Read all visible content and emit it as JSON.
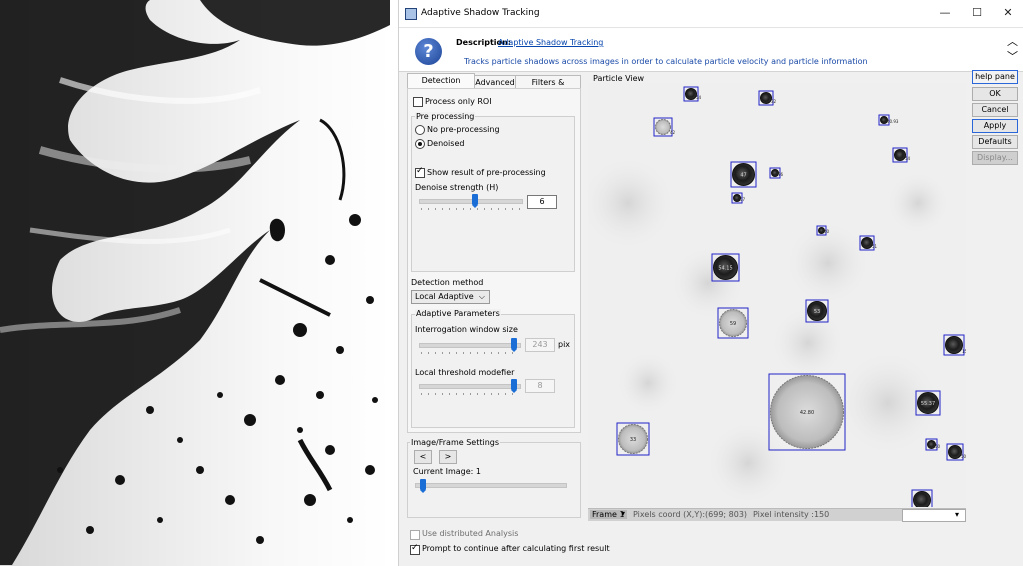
{
  "window": {
    "title": "Adaptive Shadow Tracking",
    "controls": [
      "—",
      "☐",
      "✕"
    ]
  },
  "description": {
    "label": "Description:",
    "link": "Adaptive Shadow Tracking",
    "text": "Tracks particle shadows across images in order to calculate particle velocity and particle information"
  },
  "tabs": [
    {
      "label": "Detection Method",
      "active": true
    },
    {
      "label": "Advanced",
      "active": false
    },
    {
      "label": "Filters & Tracking",
      "active": false
    }
  ],
  "detection": {
    "process_roi_label": "Process only ROI",
    "process_roi_checked": false,
    "preprocessing_title": "Pre processing",
    "no_preprocessing_label": "No pre-processing",
    "denoised_label": "Denoised",
    "selected": "Denoised",
    "show_result_label": "Show result of pre-processing",
    "show_result_checked": true,
    "denoise_label": "Denoise strength (H)",
    "denoise_value": "6",
    "denoise_fraction": 0.55,
    "method_label": "Detection method",
    "method_value": "Local Adaptive",
    "adaptive_title": "Adaptive Parameters",
    "window_label": "Interrogation window size",
    "window_value": "243",
    "window_unit": "pix",
    "window_fraction": 0.95,
    "threshold_label": "Local threshold modefier",
    "threshold_value": "8",
    "threshold_fraction": 0.95
  },
  "frames": {
    "title": "Image/Frame Settings",
    "prev": "<",
    "next": ">",
    "current_label": "Current Image: 1",
    "fraction": 0.05
  },
  "bottom": {
    "distributed_label": "Use distributed Analysis",
    "distributed_checked": false,
    "prompt_label": "Prompt to continue after calculating first result",
    "prompt_checked": true
  },
  "particle_view": {
    "title": "Particle View",
    "particles": [
      {
        "label": "54"
      },
      {
        "label": "32"
      },
      {
        "label": "42"
      },
      {
        "label": "40.93"
      },
      {
        "label": "54"
      },
      {
        "label": "47"
      },
      {
        "label": "76"
      },
      {
        "label": "57"
      },
      {
        "label": "40"
      },
      {
        "label": "51"
      },
      {
        "label": "54.15"
      },
      {
        "label": "53"
      },
      {
        "label": "59"
      },
      {
        "label": "155.33"
      },
      {
        "label": "42.80"
      },
      {
        "label": "55.37"
      },
      {
        "label": "33"
      },
      {
        "label": "50"
      },
      {
        "label": "50"
      }
    ],
    "status": {
      "frame": "Frame 1",
      "coords": "Pixels coord (X,Y):(699; 803)",
      "intensity": "Pixel intensity :150"
    }
  },
  "buttons": {
    "help": "help pane",
    "ok": "OK",
    "cancel": "Cancel",
    "apply": "Apply",
    "defaults": "Defaults",
    "display": "Display..."
  }
}
